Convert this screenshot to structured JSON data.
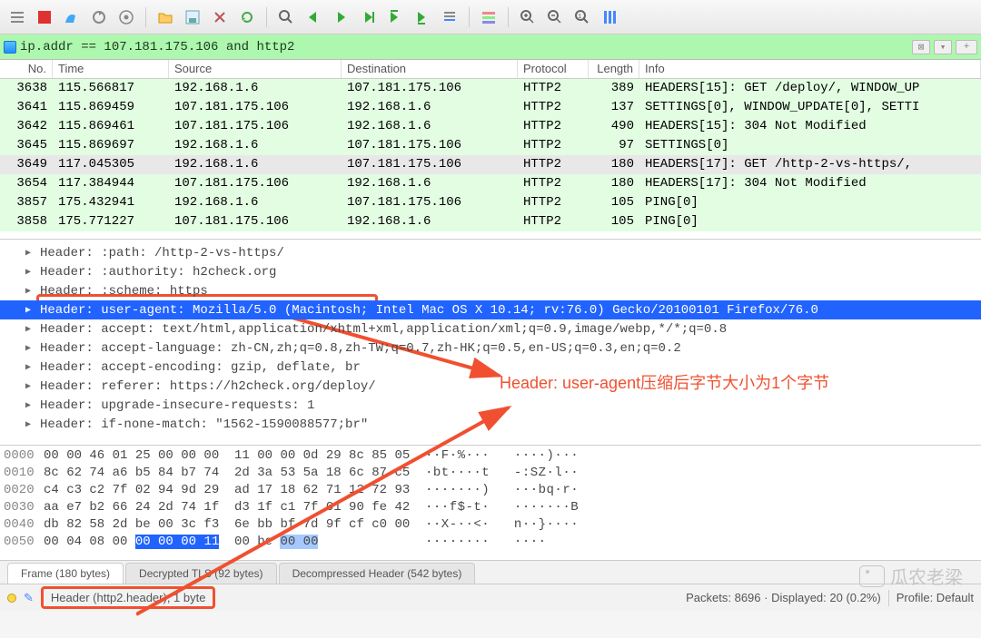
{
  "filter": {
    "expression": "ip.addr == 107.181.175.106 and http2"
  },
  "columns": {
    "no": "No.",
    "time": "Time",
    "src": "Source",
    "dst": "Destination",
    "proto": "Protocol",
    "len": "Length",
    "info": "Info"
  },
  "packets": [
    {
      "no": "3638",
      "time": "115.566817",
      "src": "192.168.1.6",
      "dst": "107.181.175.106",
      "proto": "HTTP2",
      "len": "389",
      "info": "HEADERS[15]: GET /deploy/, WINDOW_UP",
      "sel": false
    },
    {
      "no": "3641",
      "time": "115.869459",
      "src": "107.181.175.106",
      "dst": "192.168.1.6",
      "proto": "HTTP2",
      "len": "137",
      "info": "SETTINGS[0], WINDOW_UPDATE[0], SETTI",
      "sel": false
    },
    {
      "no": "3642",
      "time": "115.869461",
      "src": "107.181.175.106",
      "dst": "192.168.1.6",
      "proto": "HTTP2",
      "len": "490",
      "info": "HEADERS[15]: 304 Not Modified",
      "sel": false
    },
    {
      "no": "3645",
      "time": "115.869697",
      "src": "192.168.1.6",
      "dst": "107.181.175.106",
      "proto": "HTTP2",
      "len": "97",
      "info": "SETTINGS[0]",
      "sel": false
    },
    {
      "no": "3649",
      "time": "117.045305",
      "src": "192.168.1.6",
      "dst": "107.181.175.106",
      "proto": "HTTP2",
      "len": "180",
      "info": "HEADERS[17]: GET /http-2-vs-https/,",
      "sel": true
    },
    {
      "no": "3654",
      "time": "117.384944",
      "src": "107.181.175.106",
      "dst": "192.168.1.6",
      "proto": "HTTP2",
      "len": "180",
      "info": "HEADERS[17]: 304 Not Modified",
      "sel": false
    },
    {
      "no": "3857",
      "time": "175.432941",
      "src": "192.168.1.6",
      "dst": "107.181.175.106",
      "proto": "HTTP2",
      "len": "105",
      "info": "PING[0]",
      "sel": false
    },
    {
      "no": "3858",
      "time": "175.771227",
      "src": "107.181.175.106",
      "dst": "192.168.1.6",
      "proto": "HTTP2",
      "len": "105",
      "info": "PING[0]",
      "sel": false
    }
  ],
  "details": [
    {
      "text": "Header: :path: /http-2-vs-https/",
      "sel": false
    },
    {
      "text": "Header: :authority: h2check.org",
      "sel": false
    },
    {
      "text": "Header: :scheme: https",
      "sel": false
    },
    {
      "text": "Header: user-agent: Mozilla/5.0 (Macintosh; Intel Mac OS X 10.14; rv:76.0) Gecko/20100101 Firefox/76.0",
      "sel": true
    },
    {
      "text": "Header: accept: text/html,application/xhtml+xml,application/xml;q=0.9,image/webp,*/*;q=0.8",
      "sel": false
    },
    {
      "text": "Header: accept-language: zh-CN,zh;q=0.8,zh-TW;q=0.7,zh-HK;q=0.5,en-US;q=0.3,en;q=0.2",
      "sel": false
    },
    {
      "text": "Header: accept-encoding: gzip, deflate, br",
      "sel": false
    },
    {
      "text": "Header: referer: https://h2check.org/deploy/",
      "sel": false
    },
    {
      "text": "Header: upgrade-insecure-requests: 1",
      "sel": false
    },
    {
      "text": "Header: if-none-match: \"1562-1590088577;br\"",
      "sel": false
    }
  ],
  "annotation": "Header: user-agent压缩后字节大小为1个字节",
  "hex": [
    {
      "off": "0000",
      "bytes": "00 00 46 01 25 00 00 00  11 00 00 0d 29 8c 85 05",
      "ascii": "··F·%···   ····)···"
    },
    {
      "off": "0010",
      "bytes": "8c 62 74 a6 b5 84 b7 74  2d 3a 53 5a 18 6c 87 c5",
      "ascii": "·bt····t   -:SZ·l··"
    },
    {
      "off": "0020",
      "bytes": "c4 c3 c2 7f 02 94 9d 29  ad 17 18 62 71 12 72 93",
      "ascii": "·······)   ···bq·r·"
    },
    {
      "off": "0030",
      "bytes": "aa e7 b2 66 24 2d 74 1f  d3 1f c1 7f 01 90 fe 42",
      "ascii": "···f$-t·   ·······B"
    },
    {
      "off": "0040",
      "bytes": "db 82 58 2d be 00 3c f3  6e bb bf 7d 9f cf c0 00",
      "ascii": "··X-··<·   n··}····"
    },
    {
      "off": "0050",
      "bytes": "00 04 08 00 00 00 00 11  00 be 00 00",
      "ascii": "········   ····"
    }
  ],
  "tabs": [
    {
      "label": "Frame (180 bytes)",
      "active": true
    },
    {
      "label": "Decrypted TLS (92 bytes)",
      "active": false
    },
    {
      "label": "Decompressed Header (542 bytes)",
      "active": false
    }
  ],
  "status": {
    "field": "Header (http2.header), 1 byte",
    "packets": "Packets: 8696 · Displayed: 20 (0.2%)",
    "profile": "Profile: Default"
  },
  "watermark": "瓜农老梁"
}
